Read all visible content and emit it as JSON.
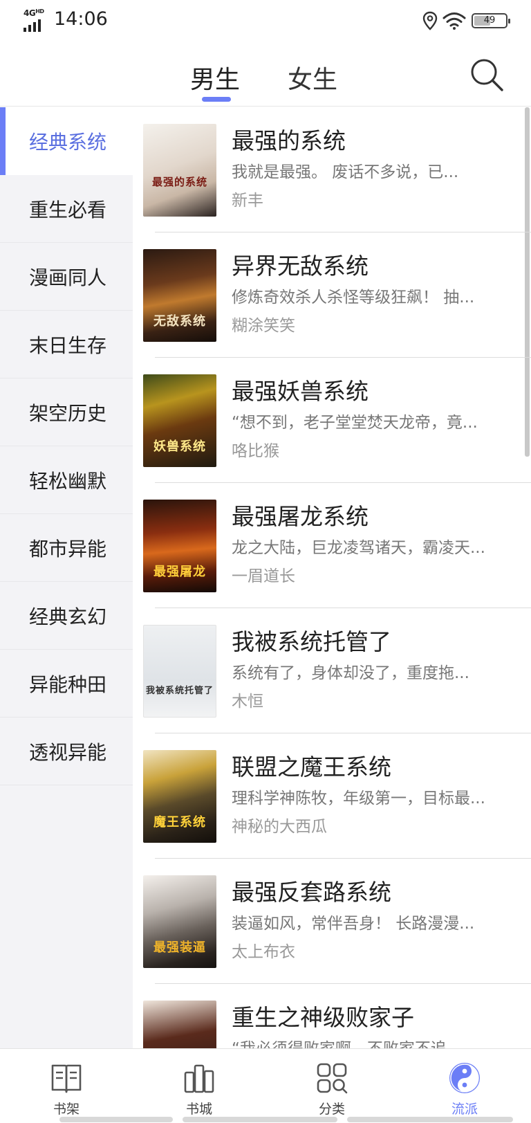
{
  "status_bar": {
    "network": "4G",
    "network_sub": "HD",
    "time": "14:06",
    "battery": "49",
    "icons": [
      "signal-icon",
      "location-icon",
      "wifi-icon",
      "battery-icon"
    ]
  },
  "top_tabs": {
    "male": "男生",
    "female": "女生",
    "active": "男生",
    "accent_color": "#6b7ef6",
    "search_icon": "search-icon"
  },
  "sidebar": {
    "items": [
      {
        "label": "经典系统",
        "active": true
      },
      {
        "label": "重生必看",
        "active": false
      },
      {
        "label": "漫画同人",
        "active": false
      },
      {
        "label": "末日生存",
        "active": false
      },
      {
        "label": "架空历史",
        "active": false
      },
      {
        "label": "轻松幽默",
        "active": false
      },
      {
        "label": "都市异能",
        "active": false
      },
      {
        "label": "经典玄幻",
        "active": false
      },
      {
        "label": "异能种田",
        "active": false
      },
      {
        "label": "透视异能",
        "active": false
      }
    ]
  },
  "books": [
    {
      "title": "最强的系统",
      "desc": "我就是最强。 废话不多说，已...",
      "author": "新丰",
      "cover_text": "最强的系统"
    },
    {
      "title": "异界无敌系统",
      "desc": "修炼奇效杀人杀怪等级狂飙！ 抽...",
      "author": "糊涂笑笑",
      "cover_text": "无敌系统"
    },
    {
      "title": "最强妖兽系统",
      "desc": "“想不到，老子堂堂焚天龙帝，竟...",
      "author": "咯比猴",
      "cover_text": "妖兽系统"
    },
    {
      "title": "最强屠龙系统",
      "desc": "龙之大陆，巨龙凌驾诸天，霸凌天...",
      "author": "一眉道长",
      "cover_text": "最强屠龙"
    },
    {
      "title": "我被系统托管了",
      "desc": "系统有了，身体却没了，重度拖...",
      "author": "木恒",
      "cover_text": "我被系统托管了"
    },
    {
      "title": "联盟之魔王系统",
      "desc": "理科学神陈牧，年级第一，目标最...",
      "author": "神秘的大西瓜",
      "cover_text": "魔王系统"
    },
    {
      "title": "最强反套路系统",
      "desc": "装逼如风，常伴吾身！ 长路漫漫...",
      "author": "太上布衣",
      "cover_text": "最强装逼"
    },
    {
      "title": "重生之神级败家子",
      "desc": "“我必须得败家啊，不败家不追...",
      "author": "",
      "cover_text": ""
    }
  ],
  "bottom_nav": {
    "items": [
      {
        "label": "书架",
        "icon": "book-icon",
        "active": false
      },
      {
        "label": "书城",
        "icon": "bookshelf-icon",
        "active": false
      },
      {
        "label": "分类",
        "icon": "category-icon",
        "active": false
      },
      {
        "label": "流派",
        "icon": "yin-yang-icon",
        "active": true
      }
    ]
  }
}
